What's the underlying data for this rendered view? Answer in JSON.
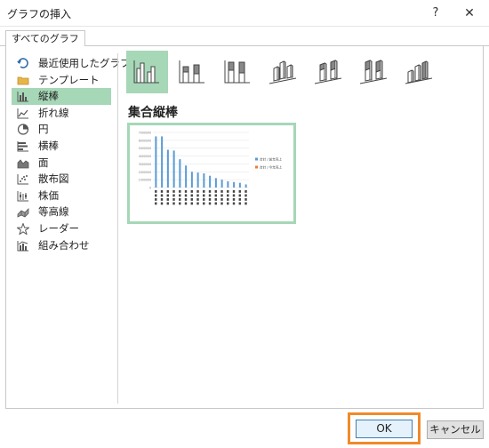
{
  "dialog": {
    "title": "グラフの挿入",
    "help_label": "?",
    "close_label": "✕"
  },
  "tabs": [
    {
      "label": "すべてのグラフ",
      "active": true
    }
  ],
  "sidebar": {
    "items": [
      {
        "label": "最近使用したグラフ",
        "icon": "recent-icon"
      },
      {
        "label": "テンプレート",
        "icon": "folder-icon"
      },
      {
        "label": "縦棒",
        "icon": "column-chart-icon",
        "selected": true
      },
      {
        "label": "折れ線",
        "icon": "line-chart-icon"
      },
      {
        "label": "円",
        "icon": "pie-chart-icon"
      },
      {
        "label": "横棒",
        "icon": "bar-chart-icon"
      },
      {
        "label": "面",
        "icon": "area-chart-icon"
      },
      {
        "label": "散布図",
        "icon": "scatter-chart-icon"
      },
      {
        "label": "株価",
        "icon": "stock-chart-icon"
      },
      {
        "label": "等高線",
        "icon": "surface-chart-icon"
      },
      {
        "label": "レーダー",
        "icon": "radar-chart-icon"
      },
      {
        "label": "組み合わせ",
        "icon": "combo-chart-icon"
      }
    ]
  },
  "subtypes": [
    {
      "name": "clustered-column",
      "selected": true
    },
    {
      "name": "stacked-column"
    },
    {
      "name": "100-stacked-column"
    },
    {
      "name": "3d-clustered-column"
    },
    {
      "name": "3d-stacked-column"
    },
    {
      "name": "3d-100-stacked-column"
    },
    {
      "name": "3d-column"
    }
  ],
  "section_title": "集合縦棒",
  "chart_data": {
    "type": "bar",
    "values": [
      6500000,
      6500000,
      4800000,
      4700000,
      3600000,
      2800000,
      2000000,
      1900000,
      1800000,
      1500000,
      1200000,
      1000000,
      800000,
      700000,
      600000,
      400000
    ],
    "ylim": [
      0,
      7000000
    ],
    "yticks": [
      "7000000",
      "6000000",
      "5000000",
      "4000000",
      "3000000",
      "2000000",
      "1000000",
      "0"
    ],
    "grid": true,
    "legend_position": "right",
    "legend": [
      "合計 / 前年売上",
      "合計 / 今年売上"
    ],
    "series_colors": [
      "#5b9bd5",
      "#ed7d31"
    ]
  },
  "buttons": {
    "ok": "OK",
    "cancel": "キャンセル"
  },
  "colors": {
    "selection": "#a6d7b7",
    "highlight_border": "#f08a2a",
    "ok_border": "#3c7fb1"
  }
}
